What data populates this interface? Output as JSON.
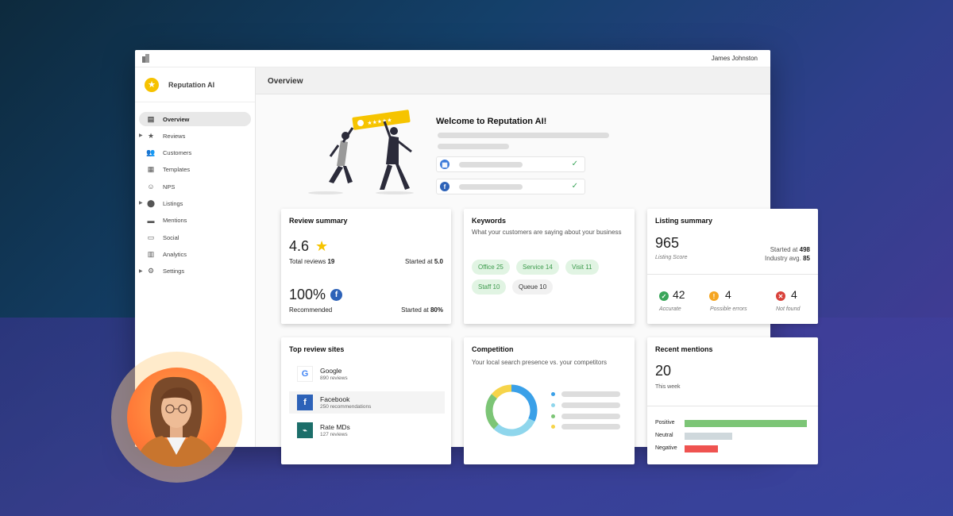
{
  "topbar": {
    "user_name": "James Johnston"
  },
  "brand": {
    "name": "Reputation AI"
  },
  "sidebar": {
    "items": [
      {
        "label": "Overview",
        "icon": "dashboard-icon",
        "active": true,
        "expandable": false
      },
      {
        "label": "Reviews",
        "icon": "star-icon",
        "active": false,
        "expandable": true
      },
      {
        "label": "Customers",
        "icon": "people-icon",
        "active": false,
        "expandable": false
      },
      {
        "label": "Templates",
        "icon": "document-icon",
        "active": false,
        "expandable": false
      },
      {
        "label": "NPS",
        "icon": "smiley-icon",
        "active": false,
        "expandable": false
      },
      {
        "label": "Listings",
        "icon": "location-pin-icon",
        "active": false,
        "expandable": true
      },
      {
        "label": "Mentions",
        "icon": "chat-icon",
        "active": false,
        "expandable": false
      },
      {
        "label": "Social",
        "icon": "social-chat-icon",
        "active": false,
        "expandable": false
      },
      {
        "label": "Analytics",
        "icon": "bar-chart-icon",
        "active": false,
        "expandable": false
      },
      {
        "label": "Settings",
        "icon": "gear-icon",
        "active": false,
        "expandable": true
      }
    ]
  },
  "header": {
    "title": "Overview"
  },
  "welcome": {
    "title": "Welcome to Reputation AI!"
  },
  "review_summary": {
    "title": "Review summary",
    "rating": "4.6",
    "total_label": "Total reviews",
    "total_value": "19",
    "started_label": "Started at",
    "started_value": "5.0",
    "percent": "100%",
    "recommended_label": "Recommended",
    "started2_label": "Started at",
    "started2_value": "80%"
  },
  "keywords": {
    "title": "Keywords",
    "subtitle": "What your customers are saying about your business",
    "chips": [
      {
        "label": "Office",
        "count": "25",
        "style": "green"
      },
      {
        "label": "Service",
        "count": "14",
        "style": "green"
      },
      {
        "label": "Visit",
        "count": "11",
        "style": "green"
      },
      {
        "label": "Staff",
        "count": "10",
        "style": "green"
      },
      {
        "label": "Queue",
        "count": "10",
        "style": "gray"
      }
    ]
  },
  "listing_summary": {
    "title": "Listing summary",
    "score": "965",
    "score_label": "Listing Score",
    "started_label": "Started at",
    "started_value": "498",
    "industry_label": "Industry avg.",
    "industry_value": "85",
    "stats": [
      {
        "value": "42",
        "label": "Accurate",
        "color": "#3aa65a",
        "icon": "check-circle-icon"
      },
      {
        "value": "4",
        "label": "Possible errors",
        "color": "#f5a623",
        "icon": "warning-circle-icon"
      },
      {
        "value": "4",
        "label": "Not found",
        "color": "#d9413a",
        "icon": "close-circle-icon"
      }
    ]
  },
  "top_sites": {
    "title": "Top review sites",
    "sites": [
      {
        "name": "Google",
        "count": "890 reviews",
        "icon": "google-icon"
      },
      {
        "name": "Facebook",
        "count": "250 recommendations",
        "icon": "facebook-icon"
      },
      {
        "name": "Rate MDs",
        "count": "127 reviews",
        "icon": "ratemds-icon"
      }
    ]
  },
  "competition": {
    "title": "Competition",
    "subtitle": "Your local search presence vs. your competitors",
    "chart_data": {
      "type": "pie",
      "values": [
        32,
        30,
        24,
        14
      ],
      "colors": [
        "#3aa0e8",
        "#8fd6ec",
        "#7cc576",
        "#f6d44a"
      ]
    }
  },
  "recent_mentions": {
    "title": "Recent mentions",
    "count": "20",
    "period": "This week",
    "chart_data": {
      "type": "bar",
      "categories": [
        "Positive",
        "Neutral",
        "Negative"
      ],
      "values": [
        100,
        39,
        27
      ],
      "colors": [
        "#7cc576",
        "#cfd8dc",
        "#ef5350"
      ]
    }
  }
}
